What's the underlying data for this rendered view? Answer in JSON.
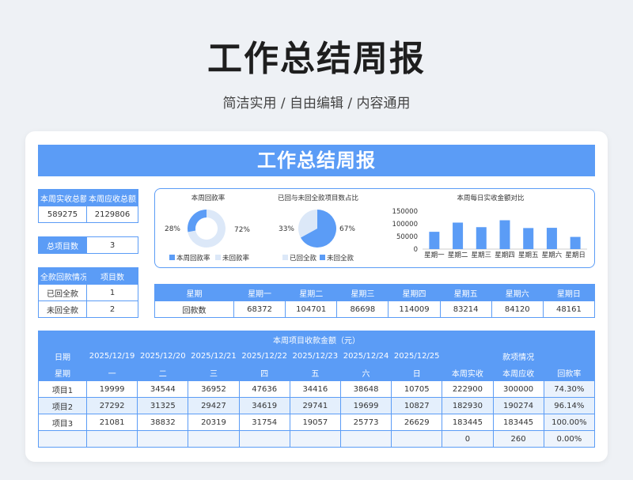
{
  "hero": {
    "title": "工作总结周报",
    "subtitle": "简洁实用 / 自由编辑 / 内容通用"
  },
  "banner": {
    "title": "工作总结周报"
  },
  "summary": {
    "actual_label": "本周实收总额",
    "due_label": "本周应收总额",
    "actual": "589275",
    "due": "2129806",
    "projects_label": "总项目数",
    "projects": "3",
    "status_header": "全款回款情况",
    "count_header": "项目数",
    "rows": [
      {
        "label": "已回全款",
        "count": "1"
      },
      {
        "label": "未回全款",
        "count": "2"
      }
    ]
  },
  "charts": {
    "colors": {
      "primary": "#5b9cf6",
      "light": "#dce8f8"
    },
    "donut1": {
      "title": "本周回款率",
      "left_pct": "28%",
      "right_pct": "72%",
      "legend_a": "本周回款率",
      "legend_b": "未回款率",
      "value": 0.28
    },
    "pie2": {
      "title": "已回与未回全款项目数占比",
      "left_pct": "33%",
      "right_pct": "67%",
      "legend_a": "已回全款",
      "legend_b": "未回全款",
      "value": 0.33
    },
    "bar": {
      "title": "本周每日实收金额对比"
    }
  },
  "chart_data": {
    "type": "bar",
    "title": "本周每日实收金额对比",
    "categories": [
      "星期一",
      "星期二",
      "星期三",
      "星期四",
      "星期五",
      "星期六",
      "星期日"
    ],
    "values": [
      68372,
      104701,
      86698,
      114009,
      83214,
      84120,
      48161
    ],
    "yticks": [
      "0",
      "50000",
      "100000",
      "150000"
    ],
    "ylim": [
      0,
      150000
    ]
  },
  "weekly": {
    "header_label": "星期",
    "days": [
      "星期一",
      "星期二",
      "星期三",
      "星期四",
      "星期五",
      "星期六",
      "星期日"
    ],
    "row_label": "回款数",
    "values": [
      "68372",
      "104701",
      "86698",
      "114009",
      "83214",
      "84120",
      "48161"
    ]
  },
  "detail": {
    "title": "本周项目收款金额（元）",
    "date_label": "日期",
    "dates": [
      "2025/12/19",
      "2025/12/20",
      "2025/12/21",
      "2025/12/22",
      "2025/12/23",
      "2025/12/24",
      "2025/12/25"
    ],
    "payment_label": "款项情况",
    "weekday_label": "星期",
    "weekdays": [
      "一",
      "二",
      "三",
      "四",
      "五",
      "六",
      "日"
    ],
    "col_actual": "本周实收",
    "col_due": "本周应收",
    "col_rate": "回款率",
    "rows": [
      {
        "name": "项目1",
        "v": [
          "19999",
          "34544",
          "36952",
          "47636",
          "34416",
          "38648",
          "10705"
        ],
        "actual": "222900",
        "due": "300000",
        "rate": "74.30%"
      },
      {
        "name": "项目2",
        "v": [
          "27292",
          "31325",
          "29427",
          "34619",
          "29741",
          "19699",
          "10827"
        ],
        "actual": "182930",
        "due": "190274",
        "rate": "96.14%"
      },
      {
        "name": "项目3",
        "v": [
          "21081",
          "38832",
          "20319",
          "31754",
          "19057",
          "25773",
          "26629"
        ],
        "actual": "183445",
        "due": "183445",
        "rate": "100.00%"
      },
      {
        "name": "",
        "v": [
          "",
          "",
          "",
          "",
          "",
          "",
          ""
        ],
        "actual": "0",
        "due": "260",
        "rate": "0.00%"
      }
    ]
  }
}
